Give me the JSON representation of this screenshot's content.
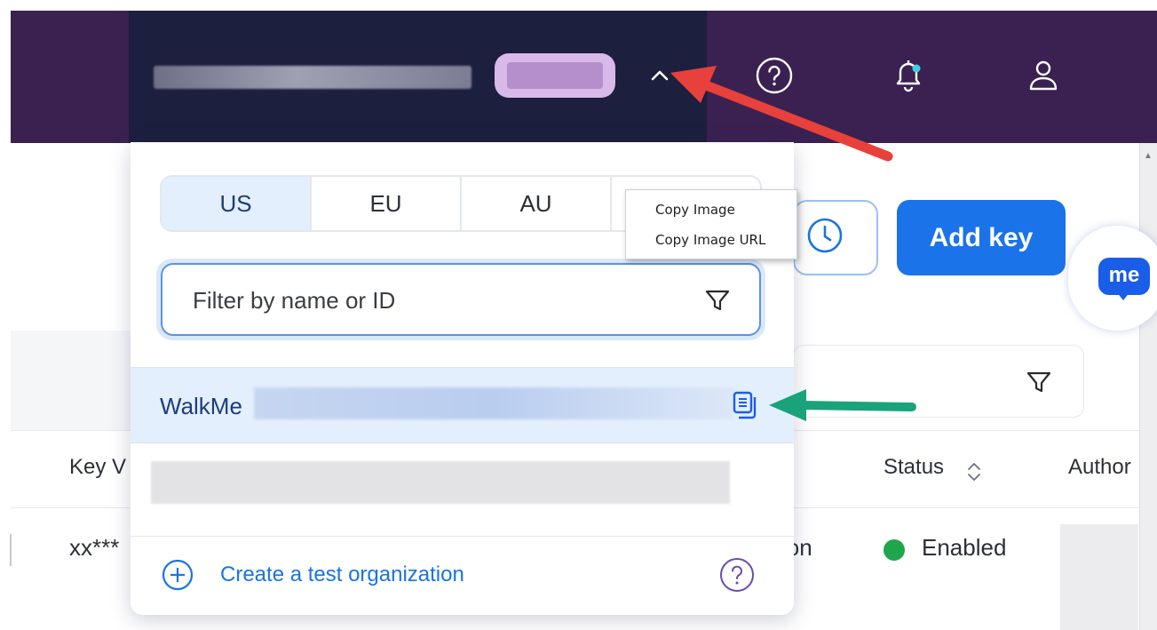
{
  "header": {
    "icons": [
      "chevron-up-icon",
      "help-icon",
      "bell-icon",
      "user-icon"
    ]
  },
  "page": {
    "add_key_label": "Add key",
    "table": {
      "headers": [
        "Key V",
        "Status",
        "Author"
      ],
      "row": {
        "key_value": "xx***",
        "partial_text": "ion",
        "status": "Enabled"
      }
    }
  },
  "chat_widget": {
    "label": "me"
  },
  "dropdown": {
    "region_tabs": [
      {
        "label": "US",
        "active": true
      },
      {
        "label": "EU",
        "active": false
      },
      {
        "label": "AU",
        "active": false
      },
      {
        "label": "",
        "active": false
      }
    ],
    "filter": {
      "placeholder": "Filter by name or ID"
    },
    "organizations": [
      {
        "name": "WalkMe",
        "selected": true
      }
    ],
    "footer": {
      "create_label": "Create a test organization"
    }
  },
  "context_menu": {
    "items": [
      "Copy Image",
      "Copy Image URL"
    ]
  },
  "colors": {
    "accent": "#1a73e8",
    "header_dark": "#1c1f3e",
    "header_purple": "#3b2150",
    "status_enabled": "#1ea74a",
    "annotation_red": "#e8403a",
    "annotation_green": "#1aa37a"
  }
}
